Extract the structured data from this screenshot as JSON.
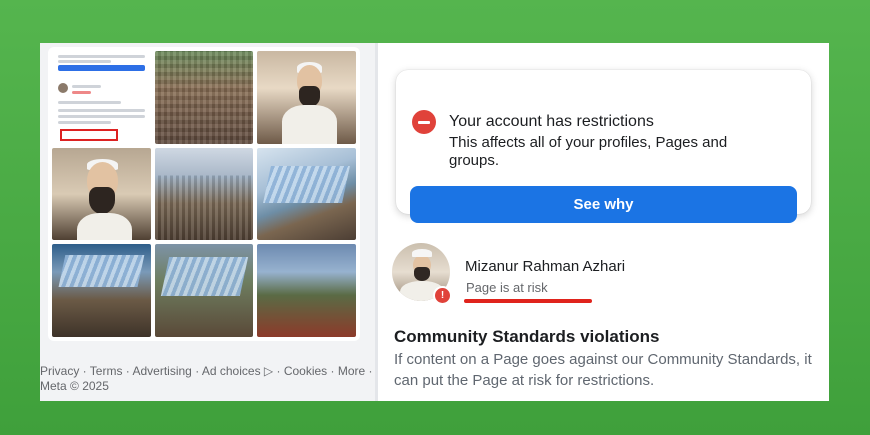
{
  "left_panel": {
    "footer": {
      "links": [
        "Privacy",
        "Terms",
        "Advertising",
        "Ad choices",
        "Cookies",
        "More"
      ],
      "separator": " · ",
      "ad_choices_icon": "ad-choices-icon",
      "copyright": "Meta © 2025"
    },
    "photo_tiles": [
      "screenshot-thumbnail",
      "crowd-photo",
      "speaker-photo",
      "speaker-closeup-photo",
      "tent-crowd-photo",
      "roof-crowd-photo",
      "aerial-roof-photo",
      "aerial-crowd-photo",
      "stage-photo"
    ]
  },
  "restriction_card": {
    "icon": "stop-icon",
    "title": "Your account has restrictions",
    "subtitle": "This affects all of your profiles, Pages and groups.",
    "button_label": "See why",
    "colors": {
      "icon": "#e0423a",
      "button": "#1b74e4"
    }
  },
  "page_status": {
    "name": "Mizanur Rahman Azhari",
    "status": "Page is at risk",
    "badge": "!",
    "underline_color": "#e0231c"
  },
  "community_standards": {
    "title": "Community Standards violations",
    "body": "If content on a Page goes against our Community Standards, it can put the Page at risk for restrictions."
  },
  "background_color": "#4caf47"
}
